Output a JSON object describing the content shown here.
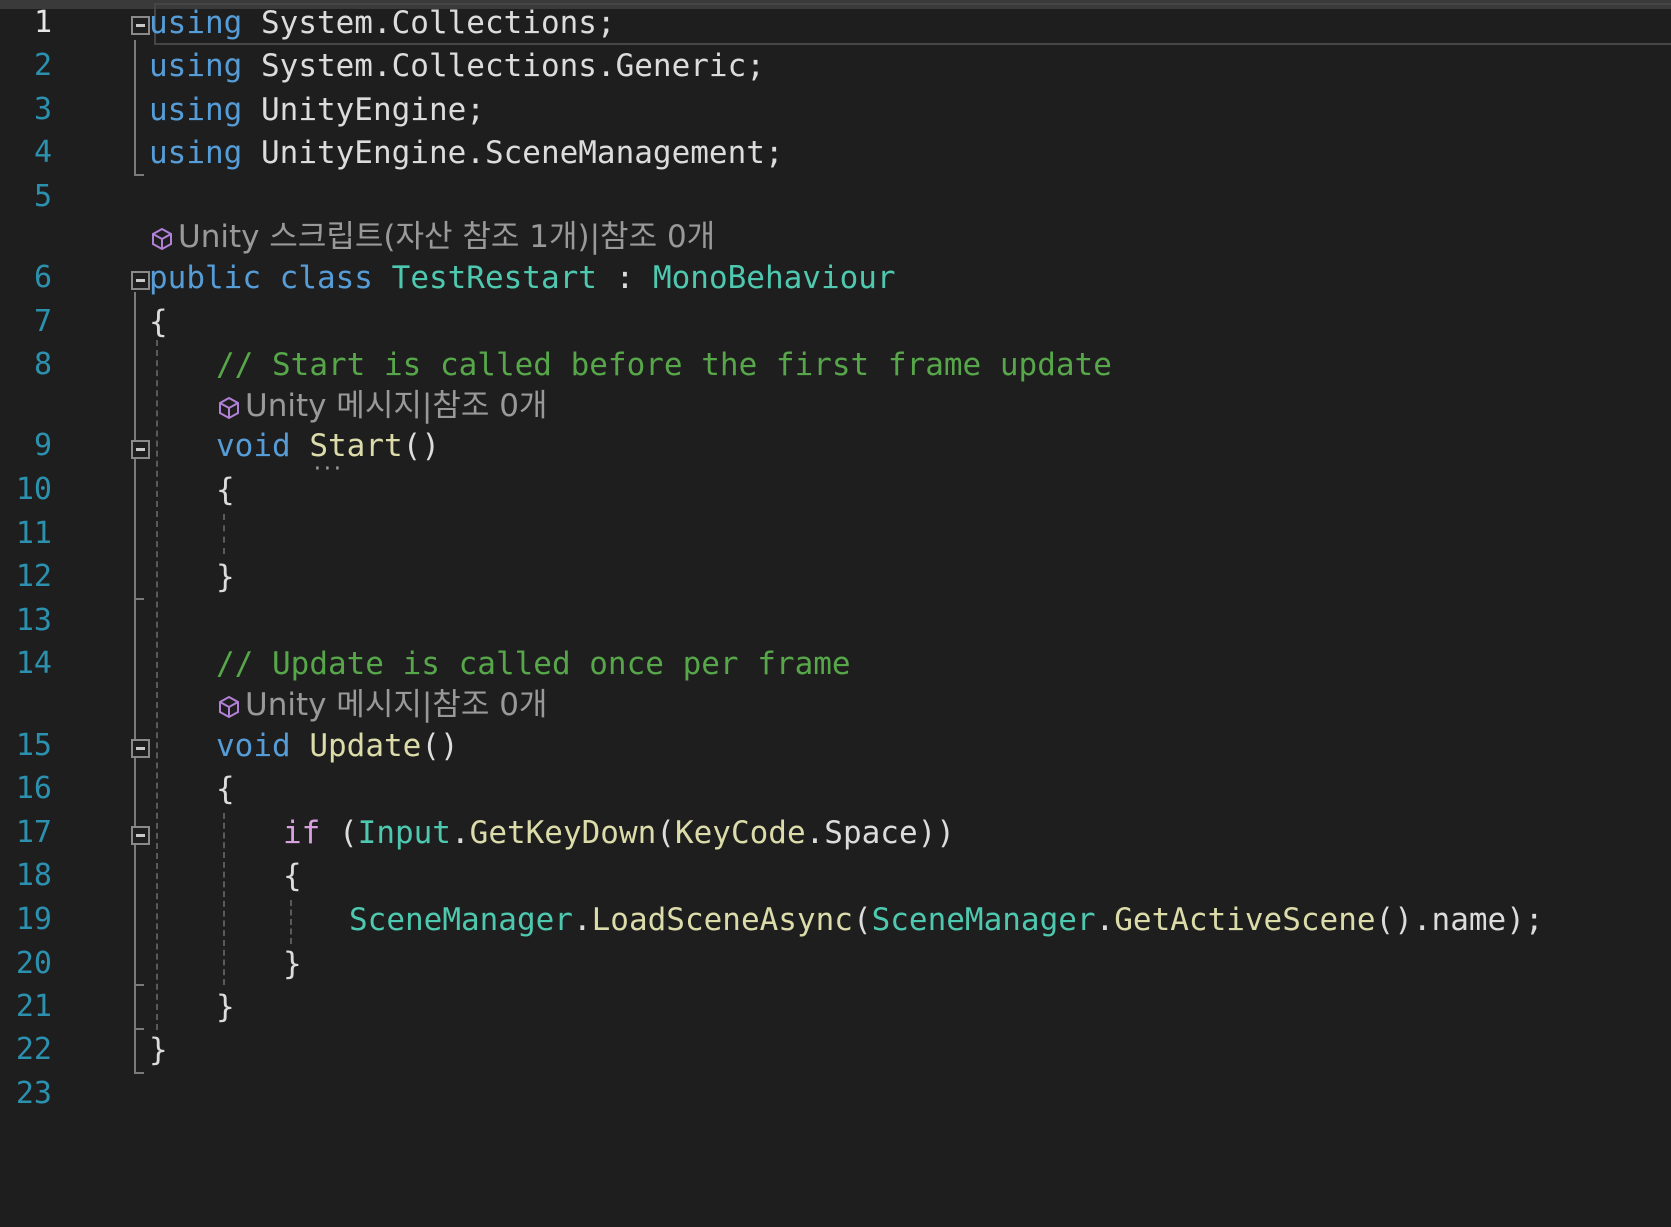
{
  "line_numbers": [
    "1",
    "2",
    "3",
    "4",
    "5",
    "6",
    "7",
    "8",
    "9",
    "10",
    "11",
    "12",
    "13",
    "14",
    "15",
    "16",
    "17",
    "18",
    "19",
    "20",
    "21",
    "22",
    "23"
  ],
  "current_line": "1",
  "codelens": {
    "class": "Unity 스크립트(자산 참조 1개)|참조 0개",
    "start": "Unity 메시지|참조 0개",
    "update": "Unity 메시지|참조 0개"
  },
  "code": {
    "l1": {
      "kw": "using",
      "rest": " System.Collections;"
    },
    "l2": {
      "kw": "using",
      "rest": " System.Collections.Generic;"
    },
    "l3": {
      "kw": "using",
      "rest": " UnityEngine;"
    },
    "l4": {
      "kw": "using",
      "rest": " UnityEngine.SceneManagement;"
    },
    "l6": {
      "kw1": "public",
      "kw2": "class",
      "name": "TestRestart",
      "colon": " : ",
      "base": "MonoBehaviour"
    },
    "l7": "{",
    "l8": "// Start is called before the first frame update",
    "l9": {
      "kw": "void",
      "fn": "Start",
      "rest": "()"
    },
    "l10": "{",
    "l12": "}",
    "l14": "// Update is called once per frame",
    "l15": {
      "kw": "void",
      "fn": "Update",
      "rest": "()"
    },
    "l16": "{",
    "l17": {
      "kw": "if",
      "p1": " (",
      "t1": "Input",
      "d1": ".",
      "fn": "GetKeyDown",
      "p2": "(",
      "t2": "KeyCode",
      "d2": ".",
      "member": "Space",
      "p3": "))"
    },
    "l18": "{",
    "l19": {
      "t1": "SceneManager",
      "d1": ".",
      "fn1": "LoadSceneAsync",
      "p1": "(",
      "t2": "SceneManager",
      "d2": ".",
      "fn2": "GetActiveScene",
      "rest": "().name);"
    },
    "l20": "}",
    "l21": "}",
    "l22": "}"
  }
}
